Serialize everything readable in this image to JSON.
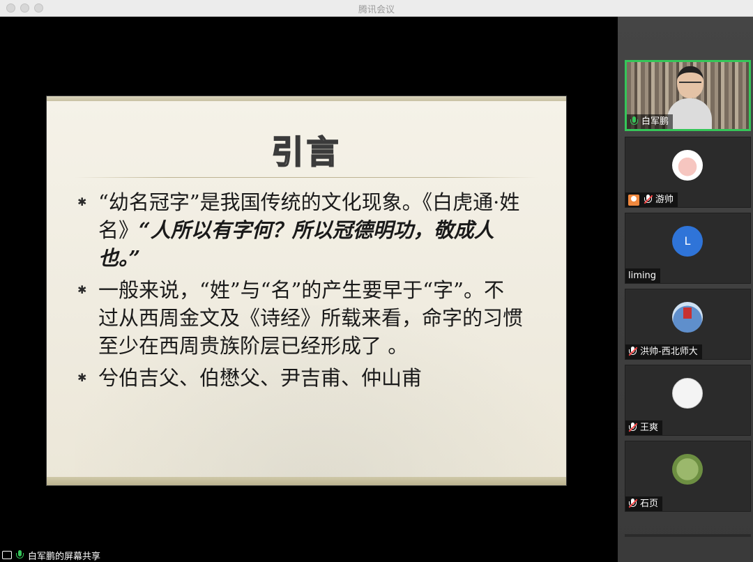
{
  "window": {
    "title": "腾讯会议"
  },
  "slide": {
    "title": "引言",
    "bullets": [
      {
        "parts": [
          {
            "text": "“幼名冠字”是我国传统的文化现象。《白虎通·姓名》",
            "emphasis": false
          },
          {
            "text": "“人所以有字何？所以冠德明功，敬成人也。”",
            "emphasis": true
          }
        ]
      },
      {
        "parts": [
          {
            "text": "一般来说，“姓”与“名”的产生要早于“字”。不过从西周金文及《诗经》所载来看，命字的习惯至少在西周贵族阶层已经形成了 。",
            "emphasis": false
          }
        ]
      },
      {
        "parts": [
          {
            "text": "兮伯吉父、伯懋父、尹吉甫、仲山甫",
            "emphasis": false
          }
        ]
      }
    ]
  },
  "participants": [
    {
      "name": "白军鹏",
      "type": "video",
      "mic": "on",
      "active": true
    },
    {
      "name": "游帅",
      "type": "avatar",
      "avatar": "pig",
      "mic": "muted",
      "host_badge": true
    },
    {
      "name": "liming",
      "type": "letter",
      "letter": "L",
      "mic": "none"
    },
    {
      "name": "洪帅-西北师大",
      "type": "avatar",
      "avatar": "flag",
      "mic": "muted"
    },
    {
      "name": "王爽",
      "type": "avatar",
      "avatar": "doodle",
      "mic": "muted"
    },
    {
      "name": "石页",
      "type": "avatar",
      "avatar": "cats",
      "mic": "muted"
    }
  ],
  "status_bar": {
    "text": "白军鹏的屏幕共享"
  },
  "colors": {
    "active_border": "#35c659",
    "muted_red": "#ff4a4a",
    "letter_avatar": "#2f74d8"
  }
}
